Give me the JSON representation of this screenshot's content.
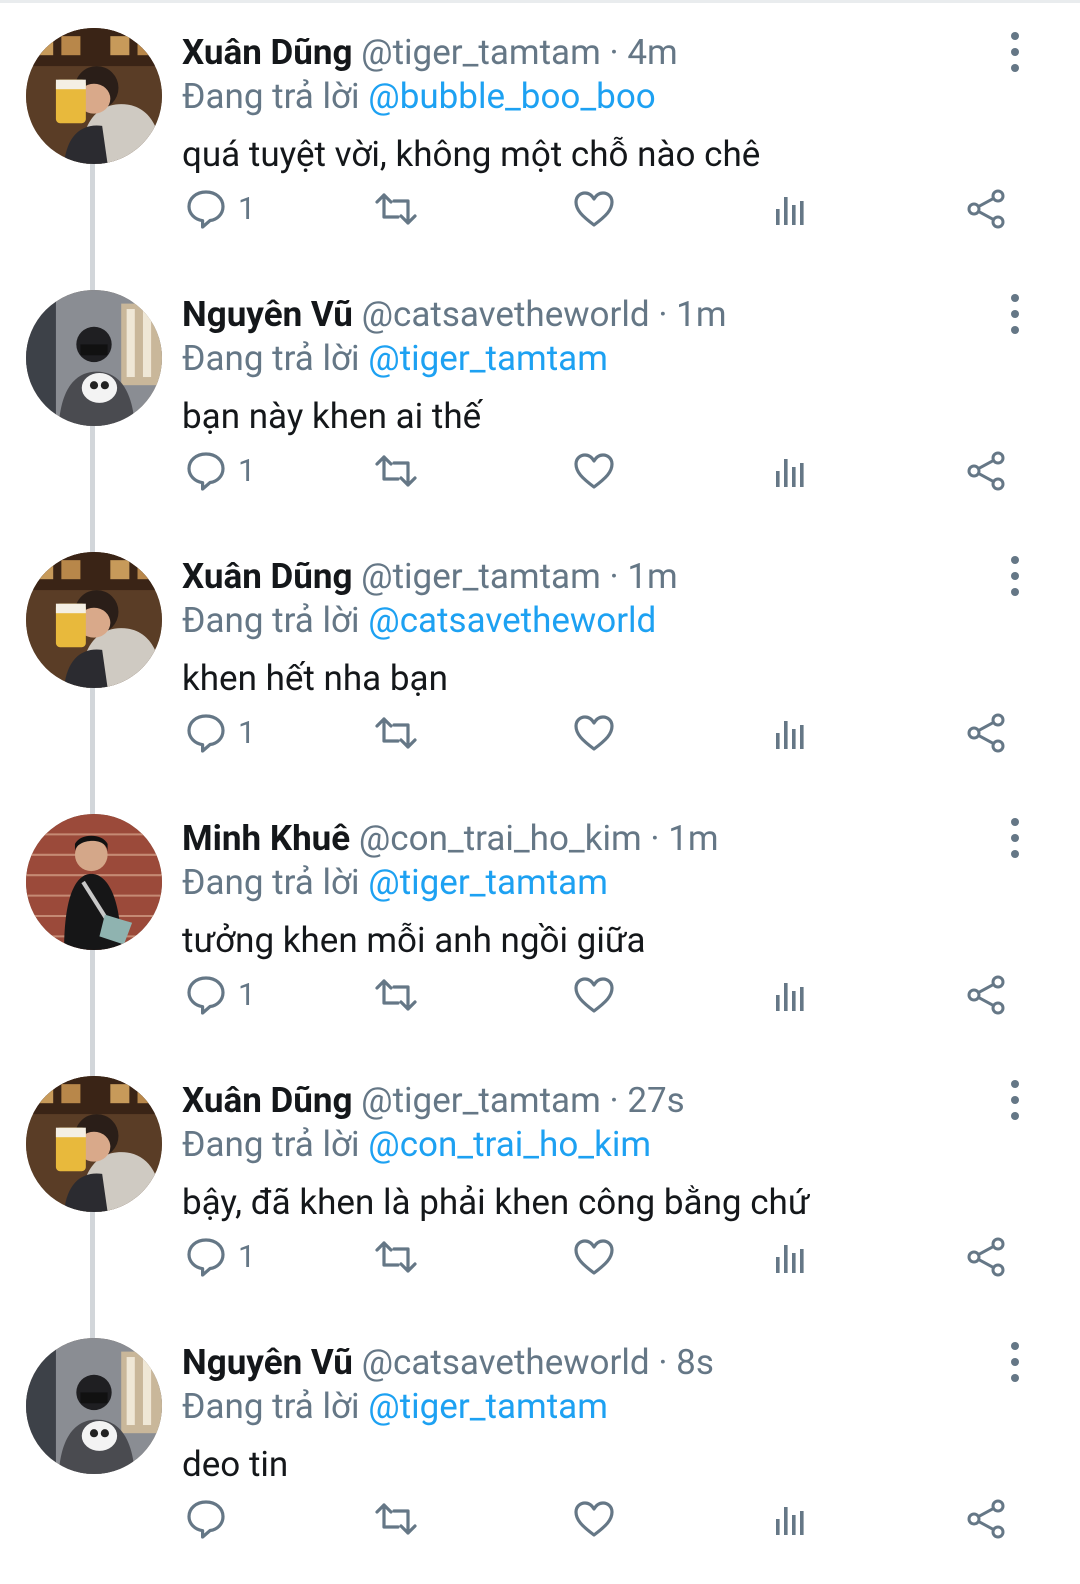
{
  "colors": {
    "name": "#14171a",
    "muted": "#657786",
    "link": "#1da1f2",
    "thread_line": "#d2d6da"
  },
  "tweets": [
    {
      "name": "Xuân Dũng",
      "handle": "@tiger_tamtam",
      "separator": "·",
      "time": "4m",
      "reply_prefix": "Đang trả lời",
      "reply_to": "@bubble_boo_boo",
      "text": "quá tuyệt vời, không một chỗ nào chê",
      "reply_count": "1",
      "avatar": "avatar-beer"
    },
    {
      "name": "Nguyên Vũ",
      "handle": "@catsavetheworld",
      "separator": "·",
      "time": "1m",
      "reply_prefix": "Đang trả lời",
      "reply_to": "@tiger_tamtam",
      "text": "bạn này khen ai thế",
      "reply_count": "1",
      "avatar": "avatar-dog"
    },
    {
      "name": "Xuân Dũng",
      "handle": "@tiger_tamtam",
      "separator": "·",
      "time": "1m",
      "reply_prefix": "Đang trả lời",
      "reply_to": "@catsavetheworld",
      "text": "khen hết nha bạn",
      "reply_count": "1",
      "avatar": "avatar-beer"
    },
    {
      "name": "Minh Khuê",
      "handle": "@con_trai_ho_kim",
      "separator": "·",
      "time": "1m",
      "reply_prefix": "Đang trả lời",
      "reply_to": "@tiger_tamtam",
      "text": "tưởng khen mỗi anh ngồi giữa",
      "reply_count": "1",
      "avatar": "avatar-brick"
    },
    {
      "name": "Xuân Dũng",
      "handle": "@tiger_tamtam",
      "separator": "·",
      "time": "27s",
      "reply_prefix": "Đang trả lời",
      "reply_to": "@con_trai_ho_kim",
      "text": "bậy, đã khen là phải khen công bằng chứ",
      "reply_count": "1",
      "avatar": "avatar-beer"
    },
    {
      "name": "Nguyên Vũ",
      "handle": "@catsavetheworld",
      "separator": "·",
      "time": "8s",
      "reply_prefix": "Đang trả lời",
      "reply_to": "@tiger_tamtam",
      "text": "deo tin",
      "reply_count": "",
      "avatar": "avatar-dog"
    }
  ]
}
